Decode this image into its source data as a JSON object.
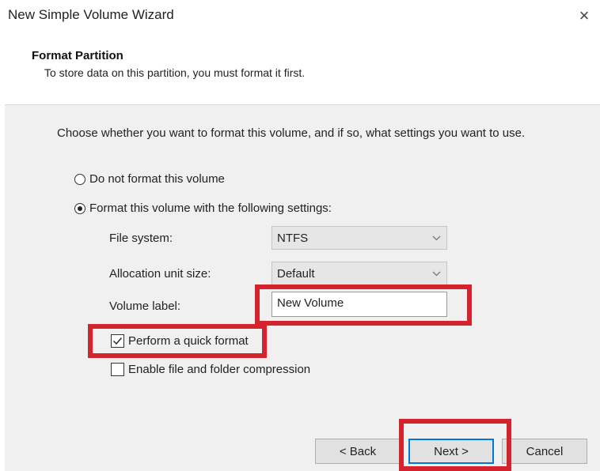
{
  "window": {
    "title": "New Simple Volume Wizard",
    "close_glyph": "×"
  },
  "header": {
    "title": "Format Partition",
    "subtitle": "To store data on this partition, you must format it first."
  },
  "instructions": "Choose whether you want to format this volume, and if so, what settings you want to use.",
  "options": {
    "no_format": {
      "label": "Do not format this volume",
      "selected": false
    },
    "format": {
      "label": "Format this volume with the following settings:",
      "selected": true
    }
  },
  "settings": {
    "file_system": {
      "label": "File system:",
      "value": "NTFS"
    },
    "allocation_unit_size": {
      "label": "Allocation unit size:",
      "value": "Default"
    },
    "volume_label": {
      "label": "Volume label:",
      "value": "New Volume"
    }
  },
  "checkboxes": {
    "quick_format": {
      "label": "Perform a quick format",
      "checked": true
    },
    "compression": {
      "label": "Enable file and folder compression",
      "checked": false
    }
  },
  "buttons": {
    "back": "< Back",
    "next": "Next >",
    "cancel": "Cancel"
  },
  "colors": {
    "highlight": "#d4232f",
    "default_button_border": "#0078d7"
  },
  "icons": {
    "close": "close-icon",
    "dropdown": "chevron-down-icon",
    "check": "checkmark-icon"
  }
}
